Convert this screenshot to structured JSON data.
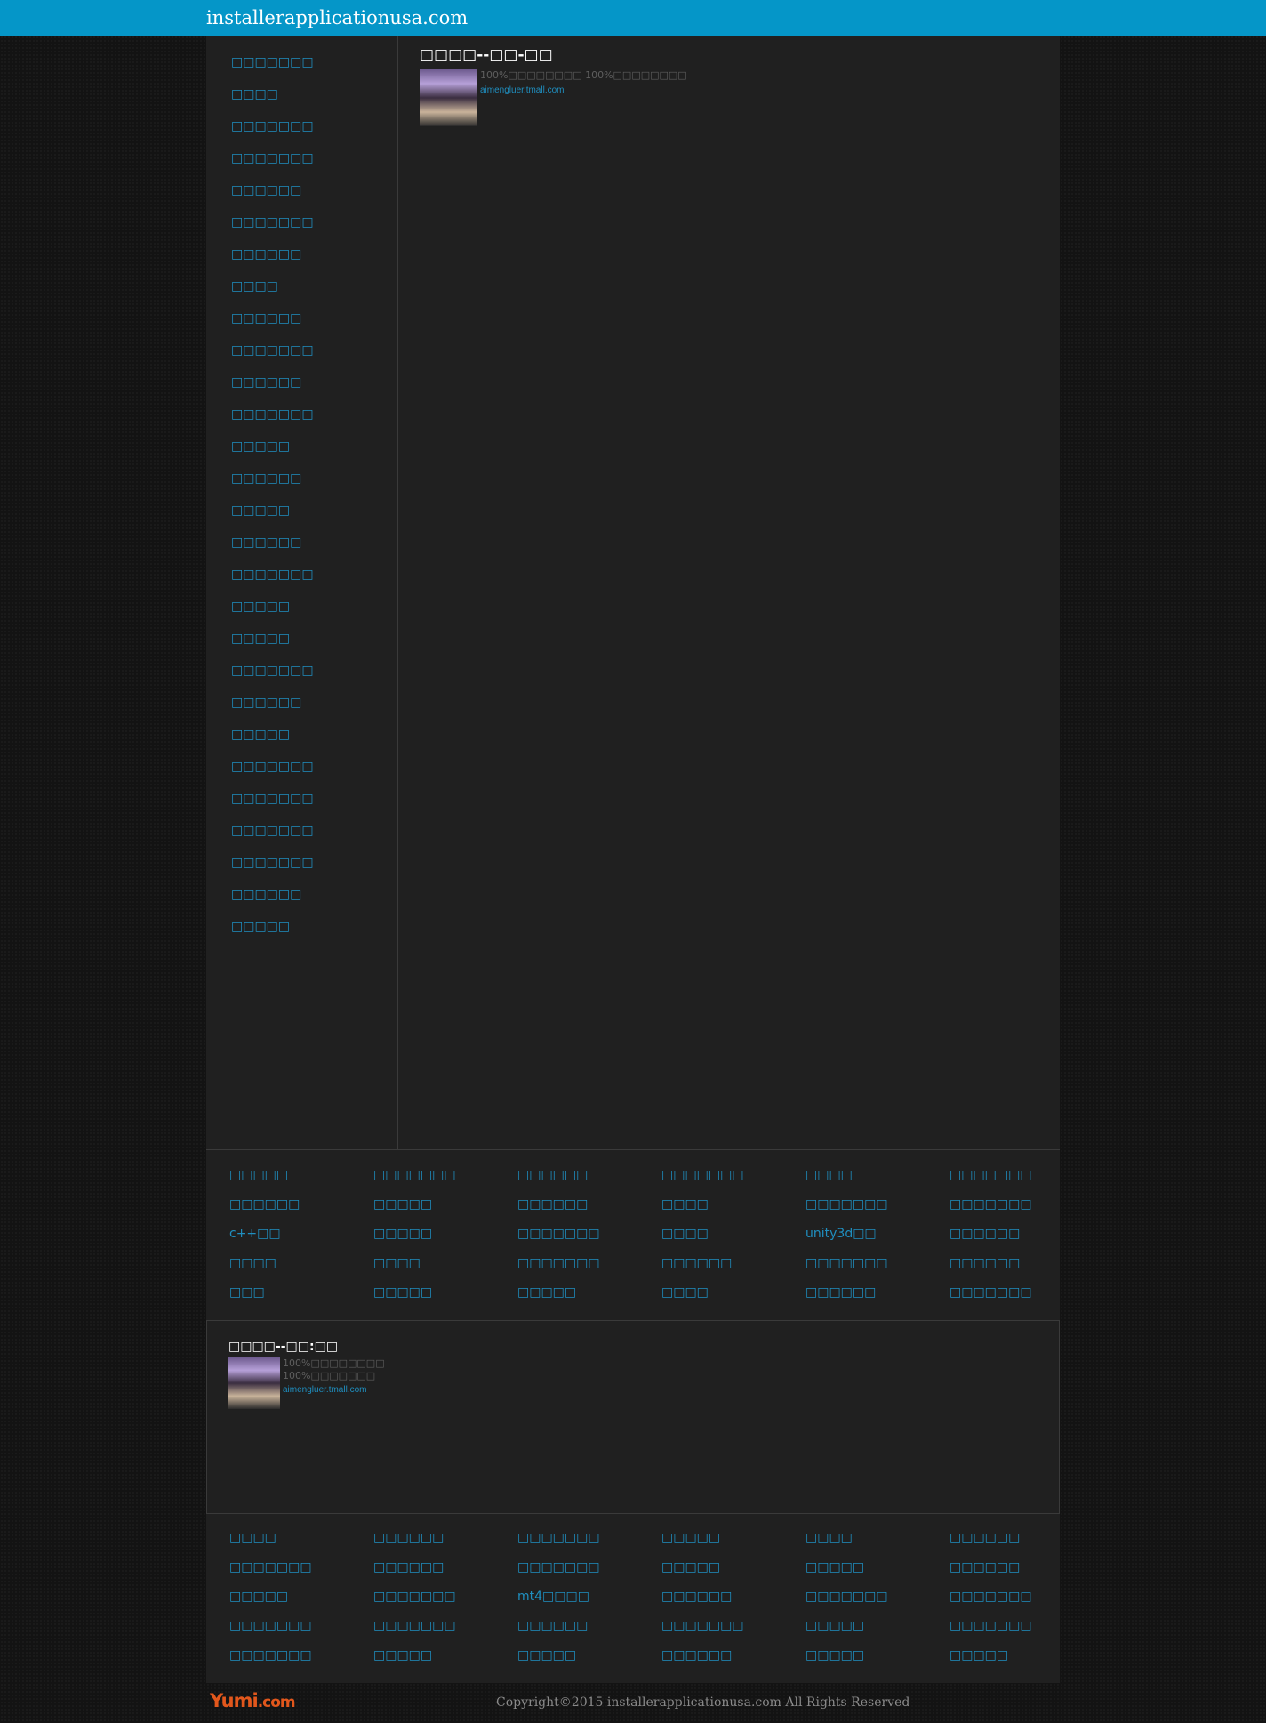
{
  "header": {
    "site_title": "installerapplicationusa.com"
  },
  "sidebar": {
    "items": [
      "□□□□□□□",
      "□□□□",
      "□□□□□□□",
      "□□□□□□□",
      "□□□□□□",
      "□□□□□□□",
      "□□□□□□",
      "□□□□",
      "□□□□□□",
      "□□□□□□□",
      "□□□□□□",
      "□□□□□□□",
      "□□□□□",
      "□□□□□□",
      "□□□□□",
      "□□□□□□",
      "□□□□□□□",
      "□□□□□",
      "□□□□□",
      "□□□□□□□",
      "□□□□□□",
      "□□□□□",
      "□□□□□□□",
      "□□□□□□□",
      "□□□□□□□",
      "□□□□□□□",
      "□□□□□□",
      "□□□□□"
    ]
  },
  "main_ad": {
    "title": "□□□□--□□-□□",
    "description": "100%□□□□□□□□ 100%□□□□□□□□",
    "link": "aimengluer.tmall.com"
  },
  "link_grid_1": [
    "□□□□□",
    "□□□□□□□",
    "□□□□□□",
    "□□□□□□□",
    "□□□□",
    "□□□□□□□",
    "□□□□□□",
    "□□□□□",
    "□□□□□□",
    "□□□□",
    "□□□□□□□",
    "□□□□□□□",
    "c++□□",
    "□□□□□",
    "□□□□□□□",
    "□□□□",
    "unity3d□□",
    "□□□□□□",
    "□□□□",
    "□□□□",
    "□□□□□□□",
    "□□□□□□",
    "□□□□□□□",
    "□□□□□□",
    "□□□",
    "□□□□□",
    "□□□□□",
    "□□□□",
    "□□□□□□",
    "□□□□□□□"
  ],
  "second_ad": {
    "title": "□□□□--□□:□□",
    "description_1": "100%□□□□□□□□",
    "description_2": "100%□□□□□□□",
    "link": "aimengluer.tmall.com"
  },
  "link_grid_2": [
    "□□□□",
    "□□□□□□",
    "□□□□□□□",
    "□□□□□",
    "□□□□",
    "□□□□□□",
    "□□□□□□□",
    "□□□□□□",
    "□□□□□□□",
    "□□□□□",
    "□□□□□",
    "□□□□□□",
    "□□□□□",
    "□□□□□□□",
    "mt4□□□□",
    "□□□□□□",
    "□□□□□□□",
    "□□□□□□□",
    "□□□□□□□",
    "□□□□□□□",
    "□□□□□□",
    "□□□□□□□",
    "□□□□□",
    "□□□□□□□",
    "□□□□□□□",
    "□□□□□",
    "□□□□□",
    "□□□□□□",
    "□□□□□",
    "□□□□□"
  ],
  "footer": {
    "logo_main": "Yumi",
    "logo_suffix": ".com",
    "copyright": "Copyright©2015 installerapplicationusa.com All Rights Reserved"
  }
}
